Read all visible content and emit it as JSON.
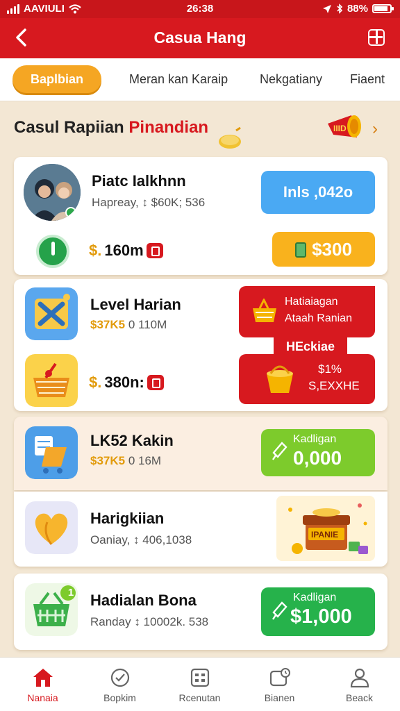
{
  "status": {
    "carrier": "AAVIULI",
    "time": "26:38",
    "battery": "88%"
  },
  "header": {
    "title": "Casua Hang",
    "back_icon": "back-arrow-icon",
    "menu_icon": "grid-menu-icon"
  },
  "tabs": [
    {
      "label": "Baplbian",
      "active": true
    },
    {
      "label": "Meran kan Karaip",
      "active": false
    },
    {
      "label": "Nekgatiany",
      "active": false
    },
    {
      "label": "Fiaent",
      "active": false
    }
  ],
  "section": {
    "title_main": "Casul Rapiian",
    "title_highlight": "Pinandian",
    "promo_badge_text": "IIID"
  },
  "cards": [
    {
      "name": "Piatc Ialkhnn",
      "sub": "Hapreay, ↕ $60K; 536",
      "button_top": "Inls ,042o",
      "amount_prefix": "$.",
      "amount": "160m",
      "button_bottom": "$300"
    },
    {
      "name": "Level Harian",
      "sub_gold": "$37K5",
      "sub_rest": "0 110M",
      "amount_prefix": "$.",
      "amount": "380n:",
      "promo_line1": "Hatiaiagan",
      "promo_line2": "Ataah Ranian",
      "ribbon": "HEckiae",
      "promo2_line1": "$1%",
      "promo2_line2": "S,EXXHE"
    },
    {
      "name": "LK52 Kakin",
      "sub_gold": "$37K5",
      "sub_rest": "0 16M",
      "button_line1": "Kadligan",
      "button_line2": "0,000"
    },
    {
      "name": "Harigkiian",
      "sub": "Oaniay, ↕ 406,1038",
      "reward_label": "IPANIE"
    },
    {
      "name": "Hadialan Bona",
      "sub": "Randay ↕ 10002k. 538",
      "badge_count": "1",
      "button_line1": "Kadligan",
      "button_line2": "$1,000"
    }
  ],
  "nav": [
    {
      "label": "Nanaia",
      "icon": "home-icon",
      "active": true
    },
    {
      "label": "Bopkim",
      "icon": "clock-check-icon",
      "active": false
    },
    {
      "label": "Rcenutan",
      "icon": "calendar-grid-icon",
      "active": false
    },
    {
      "label": "Bianen",
      "icon": "chat-clock-icon",
      "active": false
    },
    {
      "label": "Beack",
      "icon": "user-icon",
      "active": false
    }
  ],
  "colors": {
    "brand_red": "#d7191f",
    "accent_orange": "#f5a623",
    "gold": "#e29b0c",
    "green": "#26b24b",
    "blue": "#4aa9f3"
  }
}
